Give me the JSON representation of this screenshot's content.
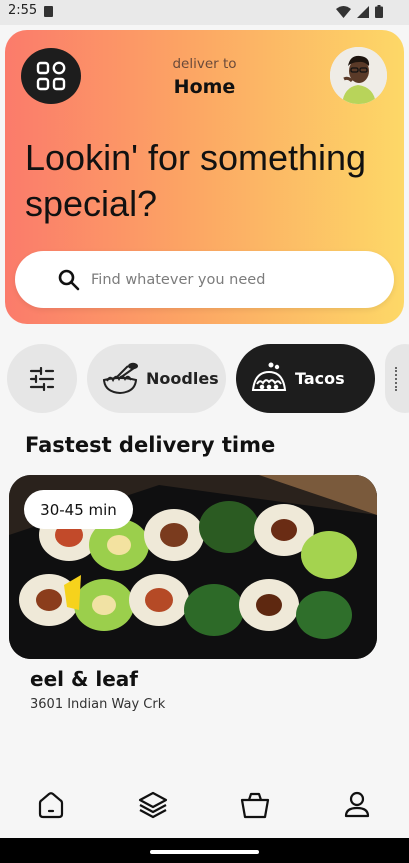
{
  "status_bar": {
    "time": "2:55"
  },
  "header": {
    "deliver_label": "deliver to",
    "deliver_location": "Home",
    "headline": "Lookin' for something special?"
  },
  "search": {
    "placeholder": "Find whatever you need",
    "value": ""
  },
  "categories": [
    {
      "label": "Noodles",
      "icon": "noodle-bowl-icon",
      "selected": false
    },
    {
      "label": "Tacos",
      "icon": "taco-icon",
      "selected": true
    }
  ],
  "section": {
    "title": "Fastest delivery time"
  },
  "restaurant": {
    "eta": "30-45 min",
    "name": "eel & leaf",
    "address": "3601 Indian Way Crk"
  },
  "bottom_nav": {
    "items": [
      "home-icon",
      "layers-icon",
      "basket-icon",
      "profile-icon"
    ],
    "active": "home-icon"
  },
  "colors": {
    "hero_gradient_start": "#fb7b6b",
    "hero_gradient_end": "#fdd867",
    "selected_chip": "#1d1d1d",
    "chip": "#e6e6e6"
  }
}
